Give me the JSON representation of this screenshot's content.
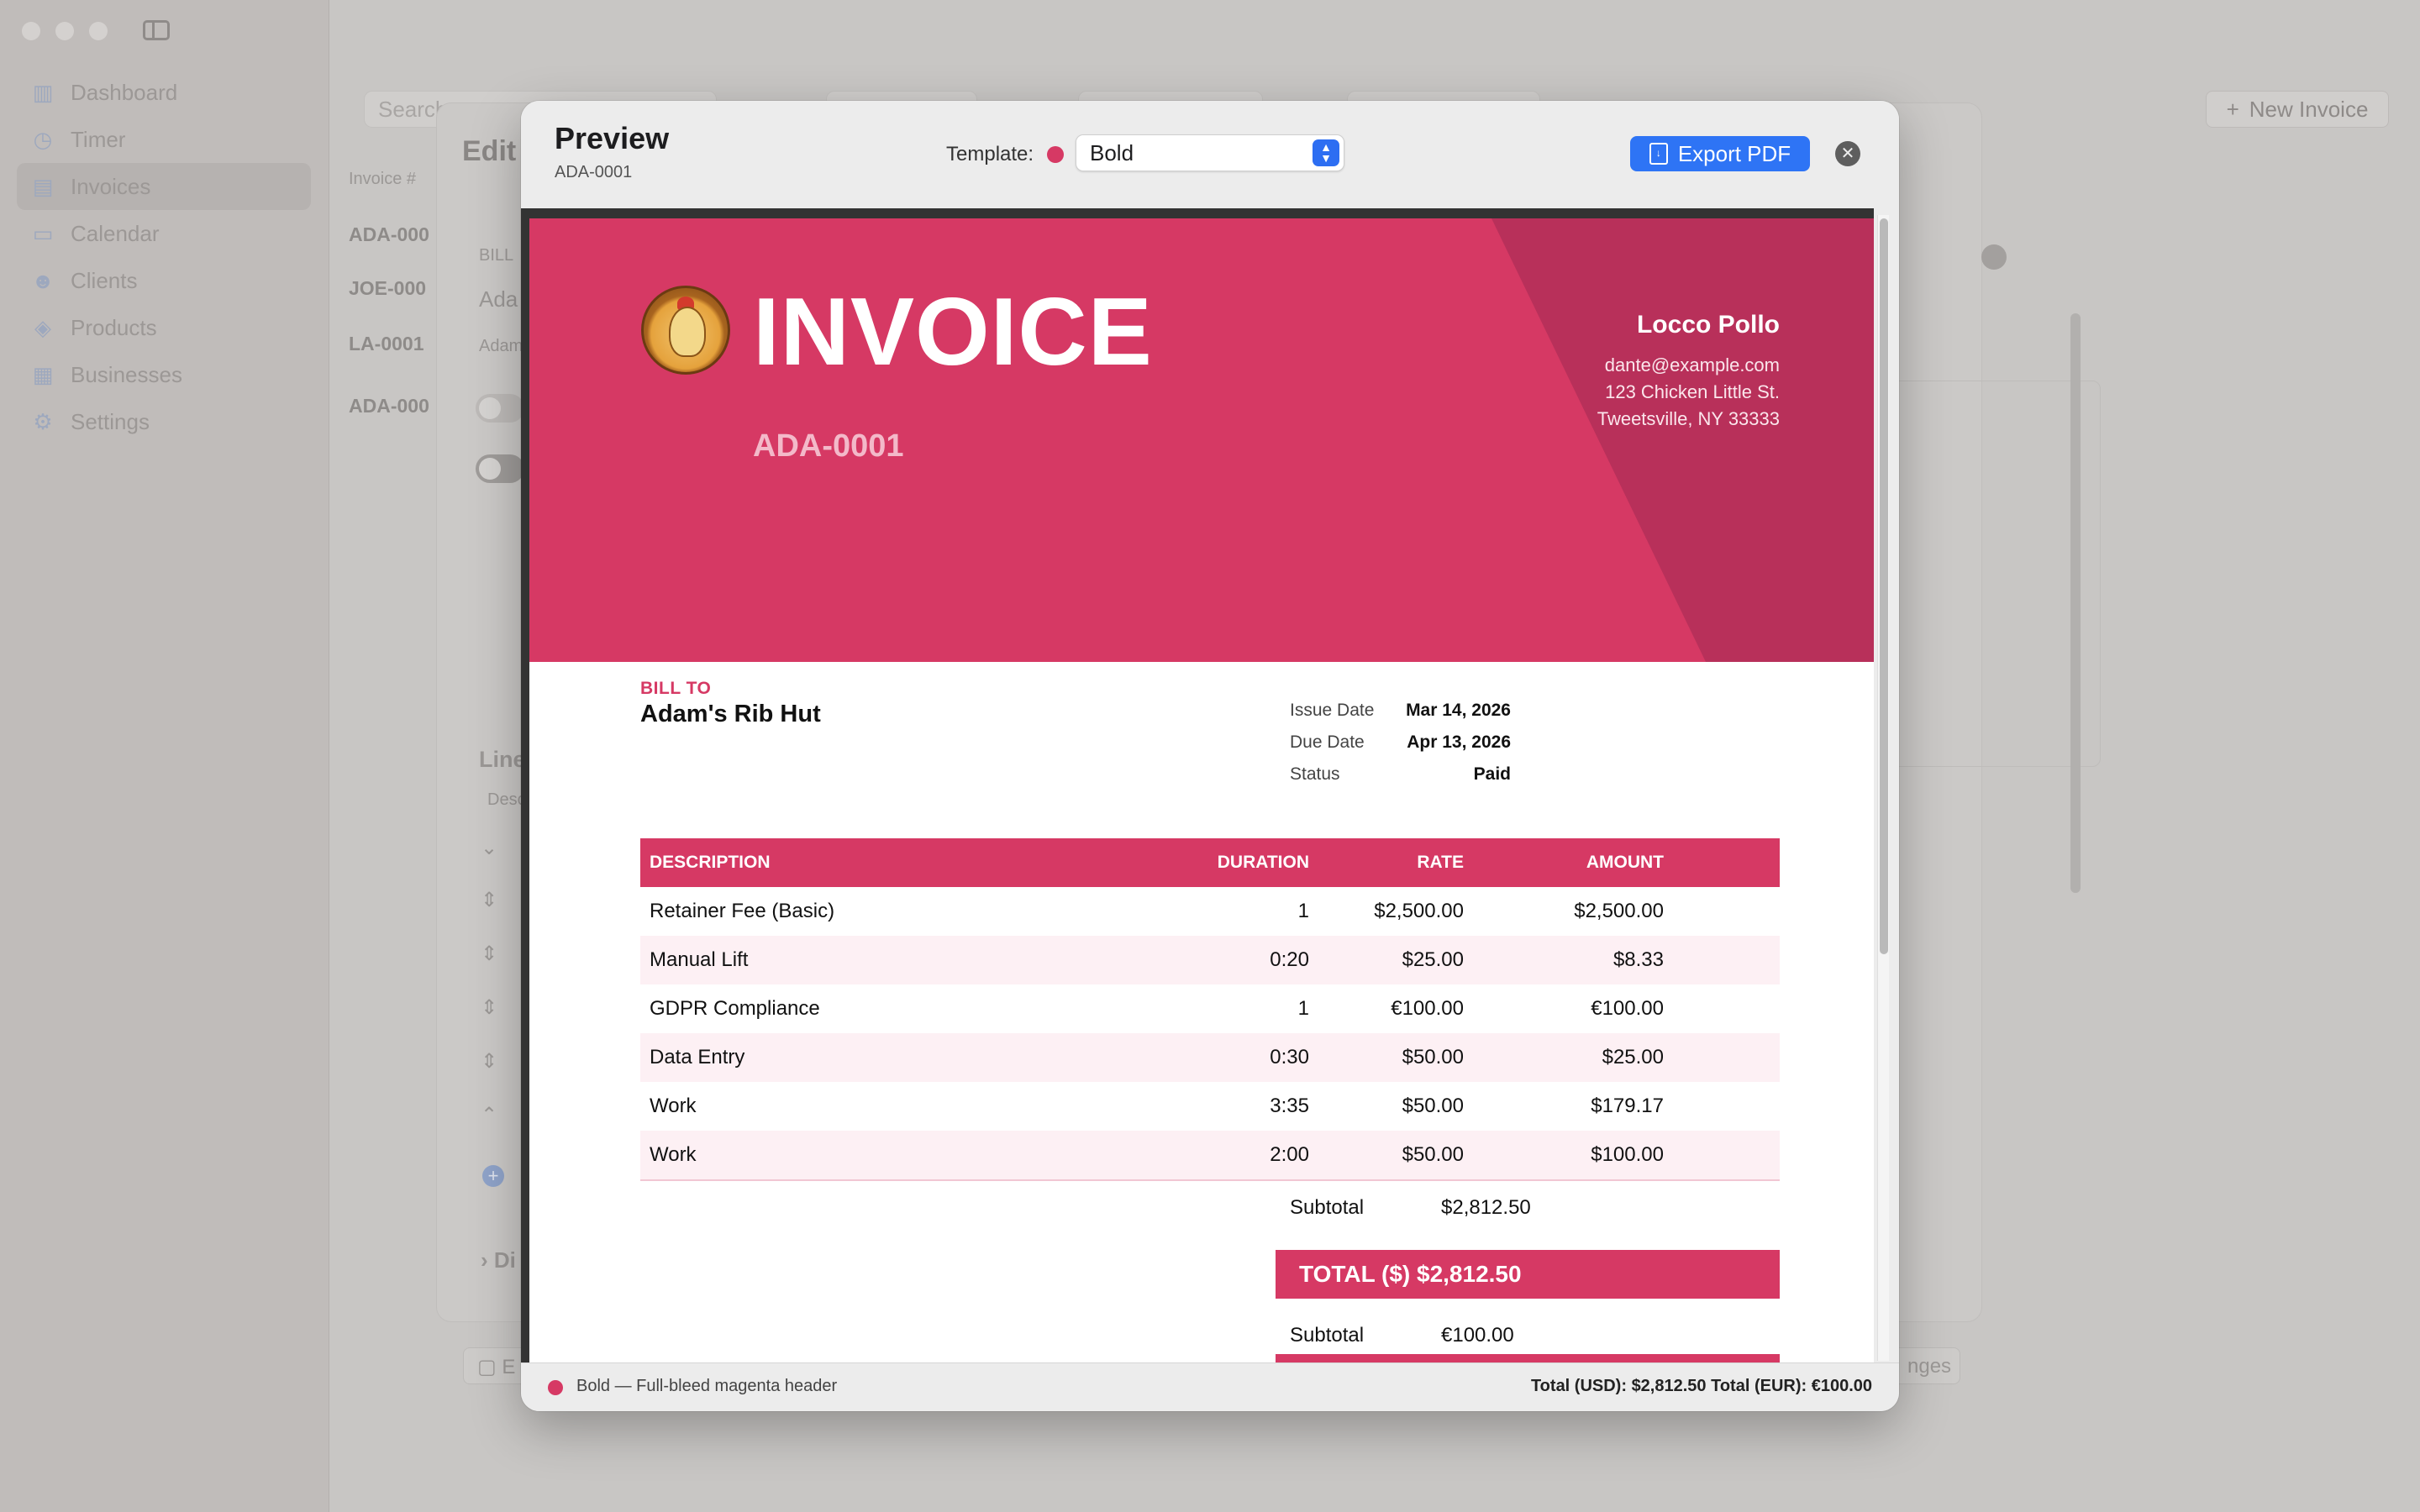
{
  "background": {
    "sidebar": {
      "items": [
        {
          "label": "Dashboard",
          "icon": "chart-bar-icon"
        },
        {
          "label": "Timer",
          "icon": "clock-icon"
        },
        {
          "label": "Invoices",
          "icon": "document-icon"
        },
        {
          "label": "Calendar",
          "icon": "calendar-icon"
        },
        {
          "label": "Clients",
          "icon": "people-icon"
        },
        {
          "label": "Products",
          "icon": "cube-icon"
        },
        {
          "label": "Businesses",
          "icon": "building-icon"
        },
        {
          "label": "Settings",
          "icon": "gear-icon"
        }
      ]
    },
    "search_placeholder": "Search",
    "new_invoice_label": "New Invoice",
    "list": {
      "header": "Invoice #",
      "rows": [
        "ADA-000",
        "JOE-000",
        "LA-0001",
        "ADA-000"
      ]
    },
    "edit_title": "Edit",
    "fragments": {
      "bill": "BILL",
      "ada": "Ada",
      "adam": "Adam",
      "line": "Line",
      "desc": "Desc",
      "di": "Di",
      "b": "E",
      "changes": "nges"
    }
  },
  "modal": {
    "title": "Preview",
    "subtitle": "ADA-0001",
    "template_label": "Template:",
    "template_value": "Bold",
    "template_color": "#d63964",
    "export_label": "Export PDF",
    "close_icon": "close-icon"
  },
  "invoice": {
    "title": "INVOICE",
    "number": "ADA-0001",
    "business": {
      "name": "Locco Pollo",
      "email": "dante@example.com",
      "address1": "123 Chicken Little St.",
      "address2": "Tweetsville, NY 33333"
    },
    "bill_to_label": "BILL TO",
    "client_name": "Adam's Rib Hut",
    "meta": {
      "issue_label": "Issue Date",
      "issue_value": "Mar 14, 2026",
      "due_label": "Due Date",
      "due_value": "Apr 13, 2026",
      "status_label": "Status",
      "status_value": "Paid"
    },
    "columns": {
      "description": "DESCRIPTION",
      "duration": "DURATION",
      "rate": "RATE",
      "amount": "AMOUNT"
    },
    "items": [
      {
        "description": "Retainer Fee (Basic)",
        "duration": "1",
        "rate": "$2,500.00",
        "amount": "$2,500.00"
      },
      {
        "description": "Manual Lift",
        "duration": "0:20",
        "rate": "$25.00",
        "amount": "$8.33"
      },
      {
        "description": "GDPR Compliance",
        "duration": "1",
        "rate": "€100.00",
        "amount": "€100.00"
      },
      {
        "description": "Data Entry",
        "duration": "0:30",
        "rate": "$50.00",
        "amount": "$25.00"
      },
      {
        "description": "Work",
        "duration": "3:35",
        "rate": "$50.00",
        "amount": "$179.17"
      },
      {
        "description": "Work",
        "duration": "2:00",
        "rate": "$50.00",
        "amount": "$100.00"
      }
    ],
    "usd_subtotal_label": "Subtotal",
    "usd_subtotal_value": "$2,812.50",
    "usd_total": "TOTAL ($) $2,812.50",
    "eur_subtotal_label": "Subtotal",
    "eur_subtotal_value": "€100.00"
  },
  "footer": {
    "template_desc": "Bold — Full-bleed magenta header",
    "totals": "Total (USD): $2,812.50   Total (EUR): €100.00"
  }
}
